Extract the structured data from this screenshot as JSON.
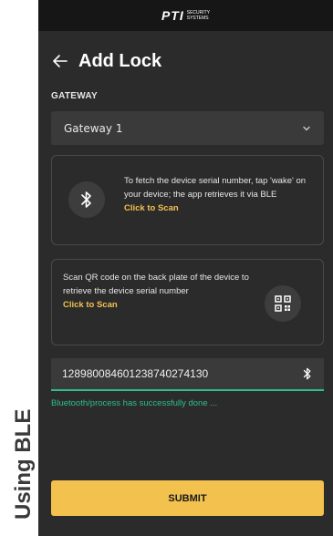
{
  "caption": "Using BLE",
  "brand": {
    "logo_main": "PTI",
    "logo_sub_1": "SECURITY",
    "logo_sub_2": "SYSTEMS"
  },
  "header": {
    "title": "Add Lock",
    "back_icon": "arrow-left-icon"
  },
  "gateway": {
    "label": "GATEWAY",
    "selected": "Gateway 1",
    "chevron_icon": "chevron-down-icon"
  },
  "ble_card": {
    "icon": "bluetooth-icon",
    "text": "To fetch the device serial number, tap 'wake' on your device; the app retrieves it via BLE",
    "link": "Click to Scan"
  },
  "qr_card": {
    "icon": "qr-code-icon",
    "text": "Scan QR code on the back plate of the device to retrieve the device serial number",
    "link": "Click to Scan"
  },
  "serial": {
    "value": "128980084601238740274130",
    "icon": "bluetooth-icon"
  },
  "status": {
    "message": "Bluetooth/process has successfully done ..."
  },
  "submit": {
    "label": "SUBMIT"
  },
  "colors": {
    "background": "#2b2b2b",
    "accent": "#f2c14e",
    "success": "#2fbf8a"
  }
}
